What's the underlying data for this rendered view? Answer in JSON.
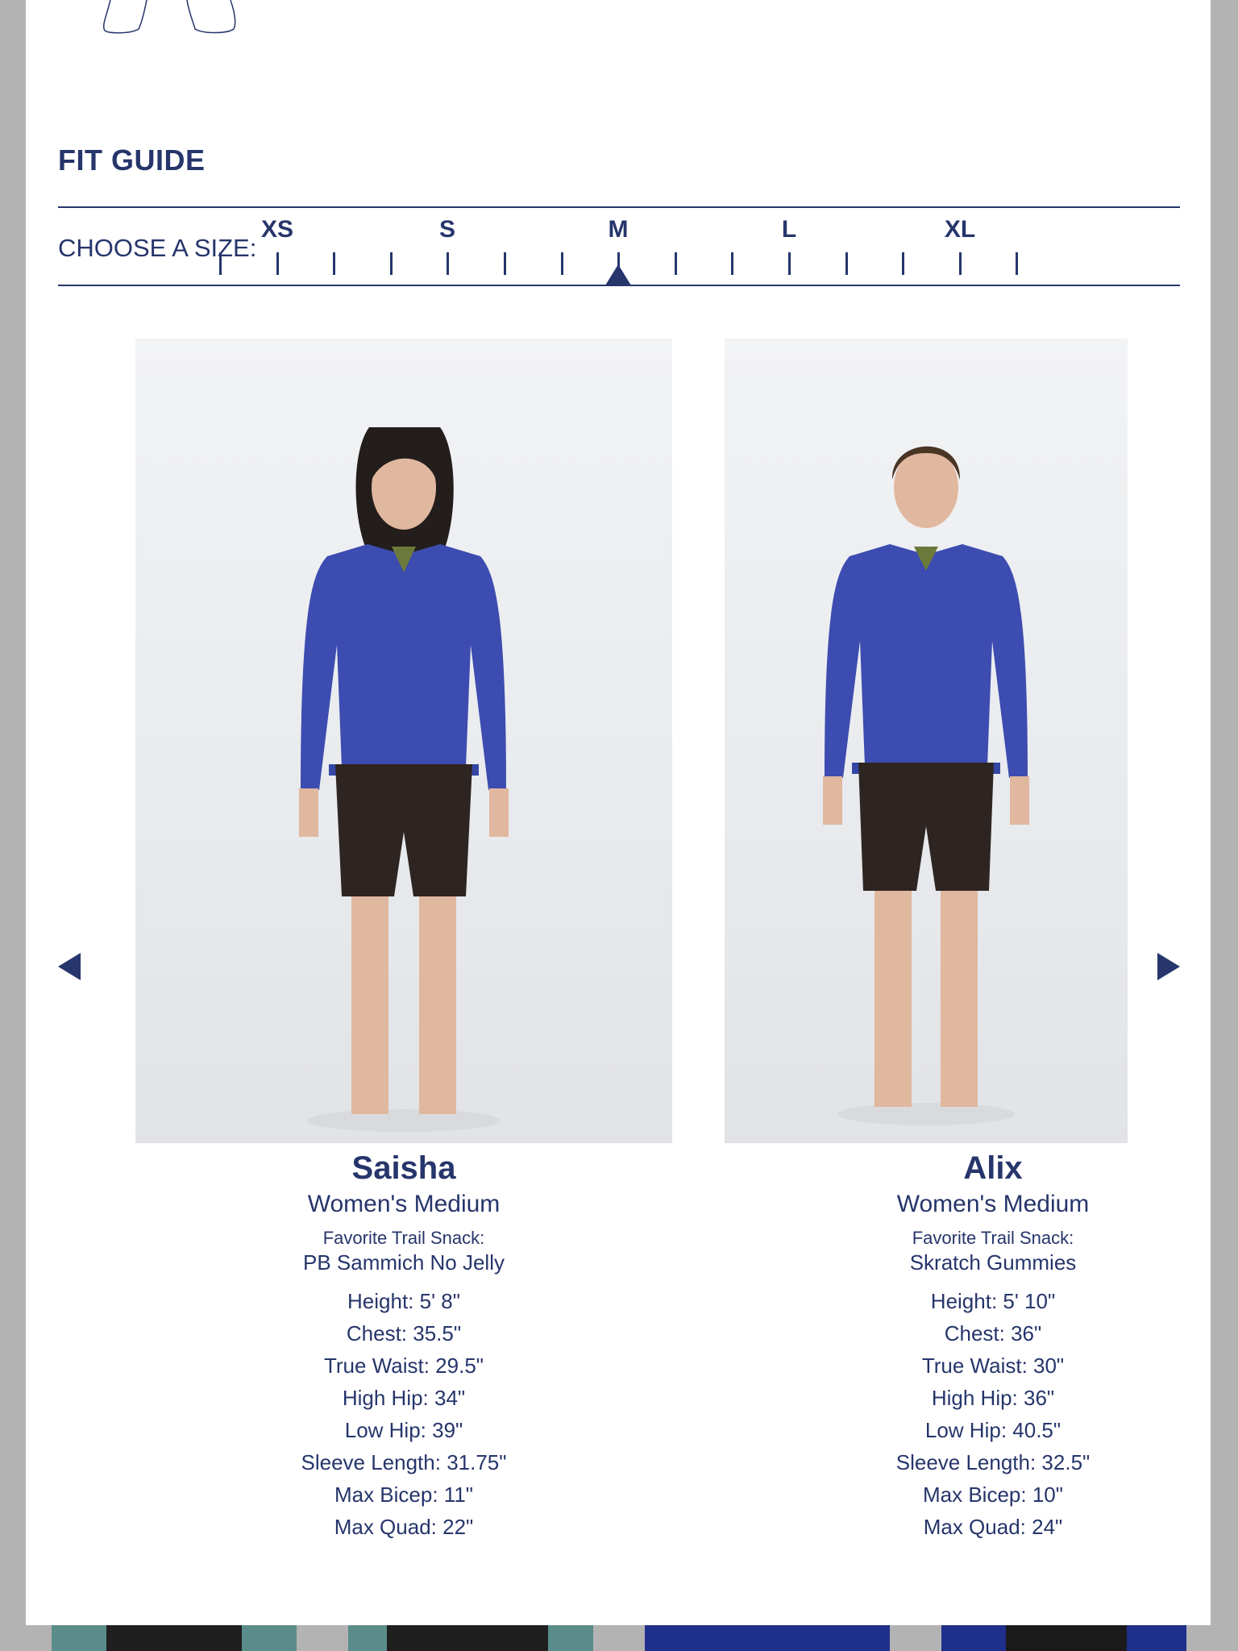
{
  "fit_guide": {
    "title": "FIT GUIDE",
    "choose_label": "CHOOSE A SIZE:",
    "sizes": [
      "XS",
      "S",
      "M",
      "L",
      "XL"
    ],
    "selected_size": "M"
  },
  "riders": [
    {
      "name": "Saisha",
      "size": "Women's Medium",
      "snack_label": "Favorite Trail Snack:",
      "snack": "PB Sammich No Jelly",
      "stats": [
        "Height: 5' 8\"",
        "Chest: 35.5\"",
        "True Waist: 29.5\"",
        "High Hip: 34\"",
        "Low Hip: 39\"",
        "Sleeve Length: 31.75\"",
        "Max Bicep: 11\"",
        "Max Quad: 22\""
      ]
    },
    {
      "name": "Alix",
      "size": "Women's Medium",
      "snack_label": "Favorite Trail Snack:",
      "snack": "Skratch Gummies",
      "stats": [
        "Height: 5' 10\"",
        "Chest: 36\"",
        "True Waist: 30\"",
        "High Hip: 36\"",
        "Low Hip: 40.5\"",
        "Sleeve Length: 32.5\"",
        "Max Bicep: 10\"",
        "Max Quad: 24\""
      ]
    }
  ],
  "icons": {
    "prev": "left-triangle-icon",
    "next": "right-triangle-icon",
    "selector": "up-triangle-icon"
  },
  "colors": {
    "navy": "#26356b",
    "backdrop": "#b3b3b3",
    "panel": "#ffffff",
    "jacket": "#3c4cb0",
    "shorts": "#2e2522",
    "teal_thumb": "#5a8c8a",
    "navy_thumb": "#1e2f8c"
  }
}
